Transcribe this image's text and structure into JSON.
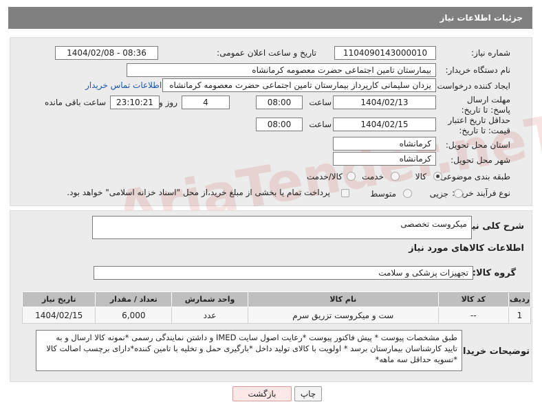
{
  "header": {
    "title": "جزئیات اطلاعات نیاز"
  },
  "form": {
    "need_number_label": "شماره نیاز:",
    "need_number": "1104090143000010",
    "announce_label": "تاریخ و ساعت اعلان عمومی:",
    "announce_value": "1404/02/08 - 08:36",
    "buyer_org_label": "نام دستگاه خریدار:",
    "buyer_org": "بیمارستان تامین اجتماعی حضرت معصومه کرمانشاه",
    "creator_label": "ایجاد کننده درخواست:",
    "creator": "یزدان  سلیمانی کارپرداز بیمارستان تامین اجتماعی حضرت معصومه کرمانشاه",
    "contact_link": "اطلاعات تماس خریدار",
    "deadline_label": "مهلت ارسال پاسخ: تا تاریخ:",
    "deadline_date": "1404/02/13",
    "time_label": "ساعت",
    "deadline_time": "08:00",
    "days_value": "4",
    "days_label": "روز و",
    "remaining_time": "23:10:21",
    "remaining_label": "ساعت باقی مانده",
    "validity_label": "حداقل تاریخ اعتبار قیمت: تا تاریخ:",
    "validity_date": "1404/02/15",
    "validity_time": "08:00",
    "province_label": "استان محل تحویل:",
    "province": "کرمانشاه",
    "city_label": "شهر محل تحویل:",
    "city": "کرمانشاه",
    "category_label": "طبقه بندی موضوعی:",
    "category_options": [
      "کالا",
      "خدمت",
      "کالا/خدمت"
    ],
    "process_label": "نوع فرآیند خرید :",
    "process_options": [
      "جزیی",
      "متوسط"
    ],
    "payment_note": "پرداخت تمام یا بخشی از مبلغ خرید،از محل \"اسناد خزانه اسلامی\" خواهد بود."
  },
  "details": {
    "description_label": "شرح کلی نیاز:",
    "description": "میکروست تخصصی",
    "goods_info_title": "اطلاعات کالاهای مورد نیاز",
    "goods_group_label": "گروه کالا:",
    "goods_group": "تجهیزات پزشکی و سلامت",
    "table": {
      "headers": [
        "ردیف",
        "کد کالا",
        "نام کالا",
        "واحد شمارش",
        "تعداد / مقدار",
        "تاریخ نیاز"
      ],
      "rows": [
        [
          "1",
          "--",
          "ست و میکروست تزریق سرم",
          "عدد",
          "6,000",
          "1404/02/15"
        ]
      ]
    },
    "notes_label": "توضیحات خریدار:",
    "notes": "طبق مشخصات پیوست * پیش فاکتور پیوست *رعایت اصول سایت IMED و داشتن نمایندگی رسمی *نمونه کالا ارسال و به تایید کارشناسان بیمارستان برسد * اولویت با کالای تولید داخل  *بارگیری حمل و تخلیه با تامین کننده*دارای برچسب اصالت کالا *تسویه حداقل سه ماهه*"
  },
  "buttons": {
    "print": "چاپ",
    "back": "بازگشت"
  },
  "watermark": {
    "text": "AriaTender.neT"
  }
}
